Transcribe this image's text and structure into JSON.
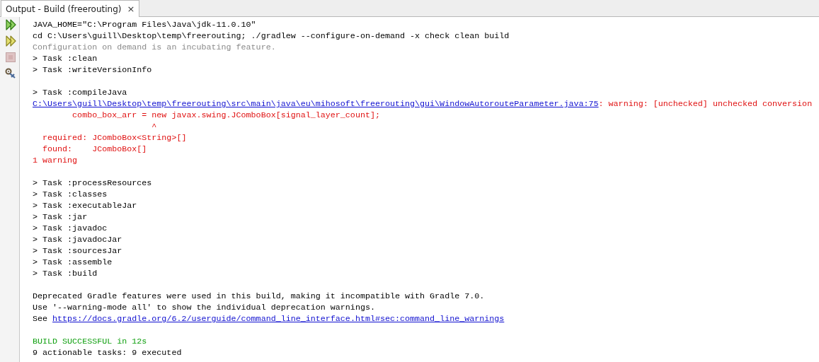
{
  "tabs": [
    {
      "label": "Output - Build (freerouting)",
      "selected": true,
      "close": "×"
    }
  ],
  "toolbar": [
    {
      "kind": "rerun",
      "disabled": false
    },
    {
      "kind": "rerun-params",
      "disabled": false
    },
    {
      "kind": "stop",
      "disabled": true
    },
    {
      "kind": "settings",
      "disabled": false
    }
  ],
  "blocks": [
    {
      "lines": [
        {
          "segments": [
            {
              "kind": "normal",
              "text": "JAVA_HOME=\"C:\\Program Files\\Java\\jdk-11.0.10\""
            }
          ]
        },
        {
          "segments": [
            {
              "kind": "normal",
              "text": "cd C:\\Users\\guill\\Desktop\\temp\\freerouting; ./gradlew --configure-on-demand -x check clean build"
            }
          ]
        },
        {
          "segments": [
            {
              "kind": "info",
              "text": "Configuration on demand is an incubating feature."
            }
          ]
        },
        {
          "segments": [
            {
              "kind": "normal",
              "text": "> Task :clean"
            }
          ]
        },
        {
          "segments": [
            {
              "kind": "normal",
              "text": "> Task :writeVersionInfo"
            }
          ]
        }
      ]
    },
    {
      "lines": [
        {
          "segments": [
            {
              "kind": "normal",
              "text": "> Task :compileJava"
            }
          ]
        },
        {
          "segments": [
            {
              "kind": "link",
              "text": "C:\\Users\\guill\\Desktop\\temp\\freerouting\\src\\main\\java\\eu\\mihosoft\\freerouting\\gui\\WindowAutorouteParameter.java:75"
            },
            {
              "kind": "error",
              "text": ": warning: [unchecked] unchecked conversion"
            }
          ]
        },
        {
          "segments": [
            {
              "kind": "error",
              "text": "        combo_box_arr = new javax.swing.JComboBox[signal_layer_count];"
            }
          ]
        },
        {
          "segments": [
            {
              "kind": "error",
              "text": "                        ^"
            }
          ]
        },
        {
          "segments": [
            {
              "kind": "error",
              "text": "  required: JComboBox<String>[]"
            }
          ]
        },
        {
          "segments": [
            {
              "kind": "error",
              "text": "  found:    JComboBox[]"
            }
          ]
        },
        {
          "segments": [
            {
              "kind": "error",
              "text": "1 warning"
            }
          ]
        }
      ]
    },
    {
      "lines": [
        {
          "segments": [
            {
              "kind": "normal",
              "text": "> Task :processResources"
            }
          ]
        },
        {
          "segments": [
            {
              "kind": "normal",
              "text": "> Task :classes"
            }
          ]
        },
        {
          "segments": [
            {
              "kind": "normal",
              "text": "> Task :executableJar"
            }
          ]
        },
        {
          "segments": [
            {
              "kind": "normal",
              "text": "> Task :jar"
            }
          ]
        },
        {
          "segments": [
            {
              "kind": "normal",
              "text": "> Task :javadoc"
            }
          ]
        },
        {
          "segments": [
            {
              "kind": "normal",
              "text": "> Task :javadocJar"
            }
          ]
        },
        {
          "segments": [
            {
              "kind": "normal",
              "text": "> Task :sourcesJar"
            }
          ]
        },
        {
          "segments": [
            {
              "kind": "normal",
              "text": "> Task :assemble"
            }
          ]
        },
        {
          "segments": [
            {
              "kind": "normal",
              "text": "> Task :build"
            }
          ]
        }
      ]
    },
    {
      "lines": [
        {
          "segments": [
            {
              "kind": "normal",
              "text": "Deprecated Gradle features were used in this build, making it incompatible with Gradle 7.0."
            }
          ]
        },
        {
          "segments": [
            {
              "kind": "normal",
              "text": "Use '--warning-mode all' to show the individual deprecation warnings."
            }
          ]
        },
        {
          "segments": [
            {
              "kind": "normal",
              "text": "See "
            },
            {
              "kind": "link",
              "text": "https://docs.gradle.org/6.2/userguide/command_line_interface.html#sec:command_line_warnings"
            }
          ]
        }
      ]
    },
    {
      "lines": [
        {
          "segments": [
            {
              "kind": "success",
              "text": "BUILD SUCCESSFUL in 12s"
            }
          ]
        },
        {
          "segments": [
            {
              "kind": "normal",
              "text": "9 actionable tasks: 9 executed"
            }
          ]
        }
      ]
    }
  ]
}
